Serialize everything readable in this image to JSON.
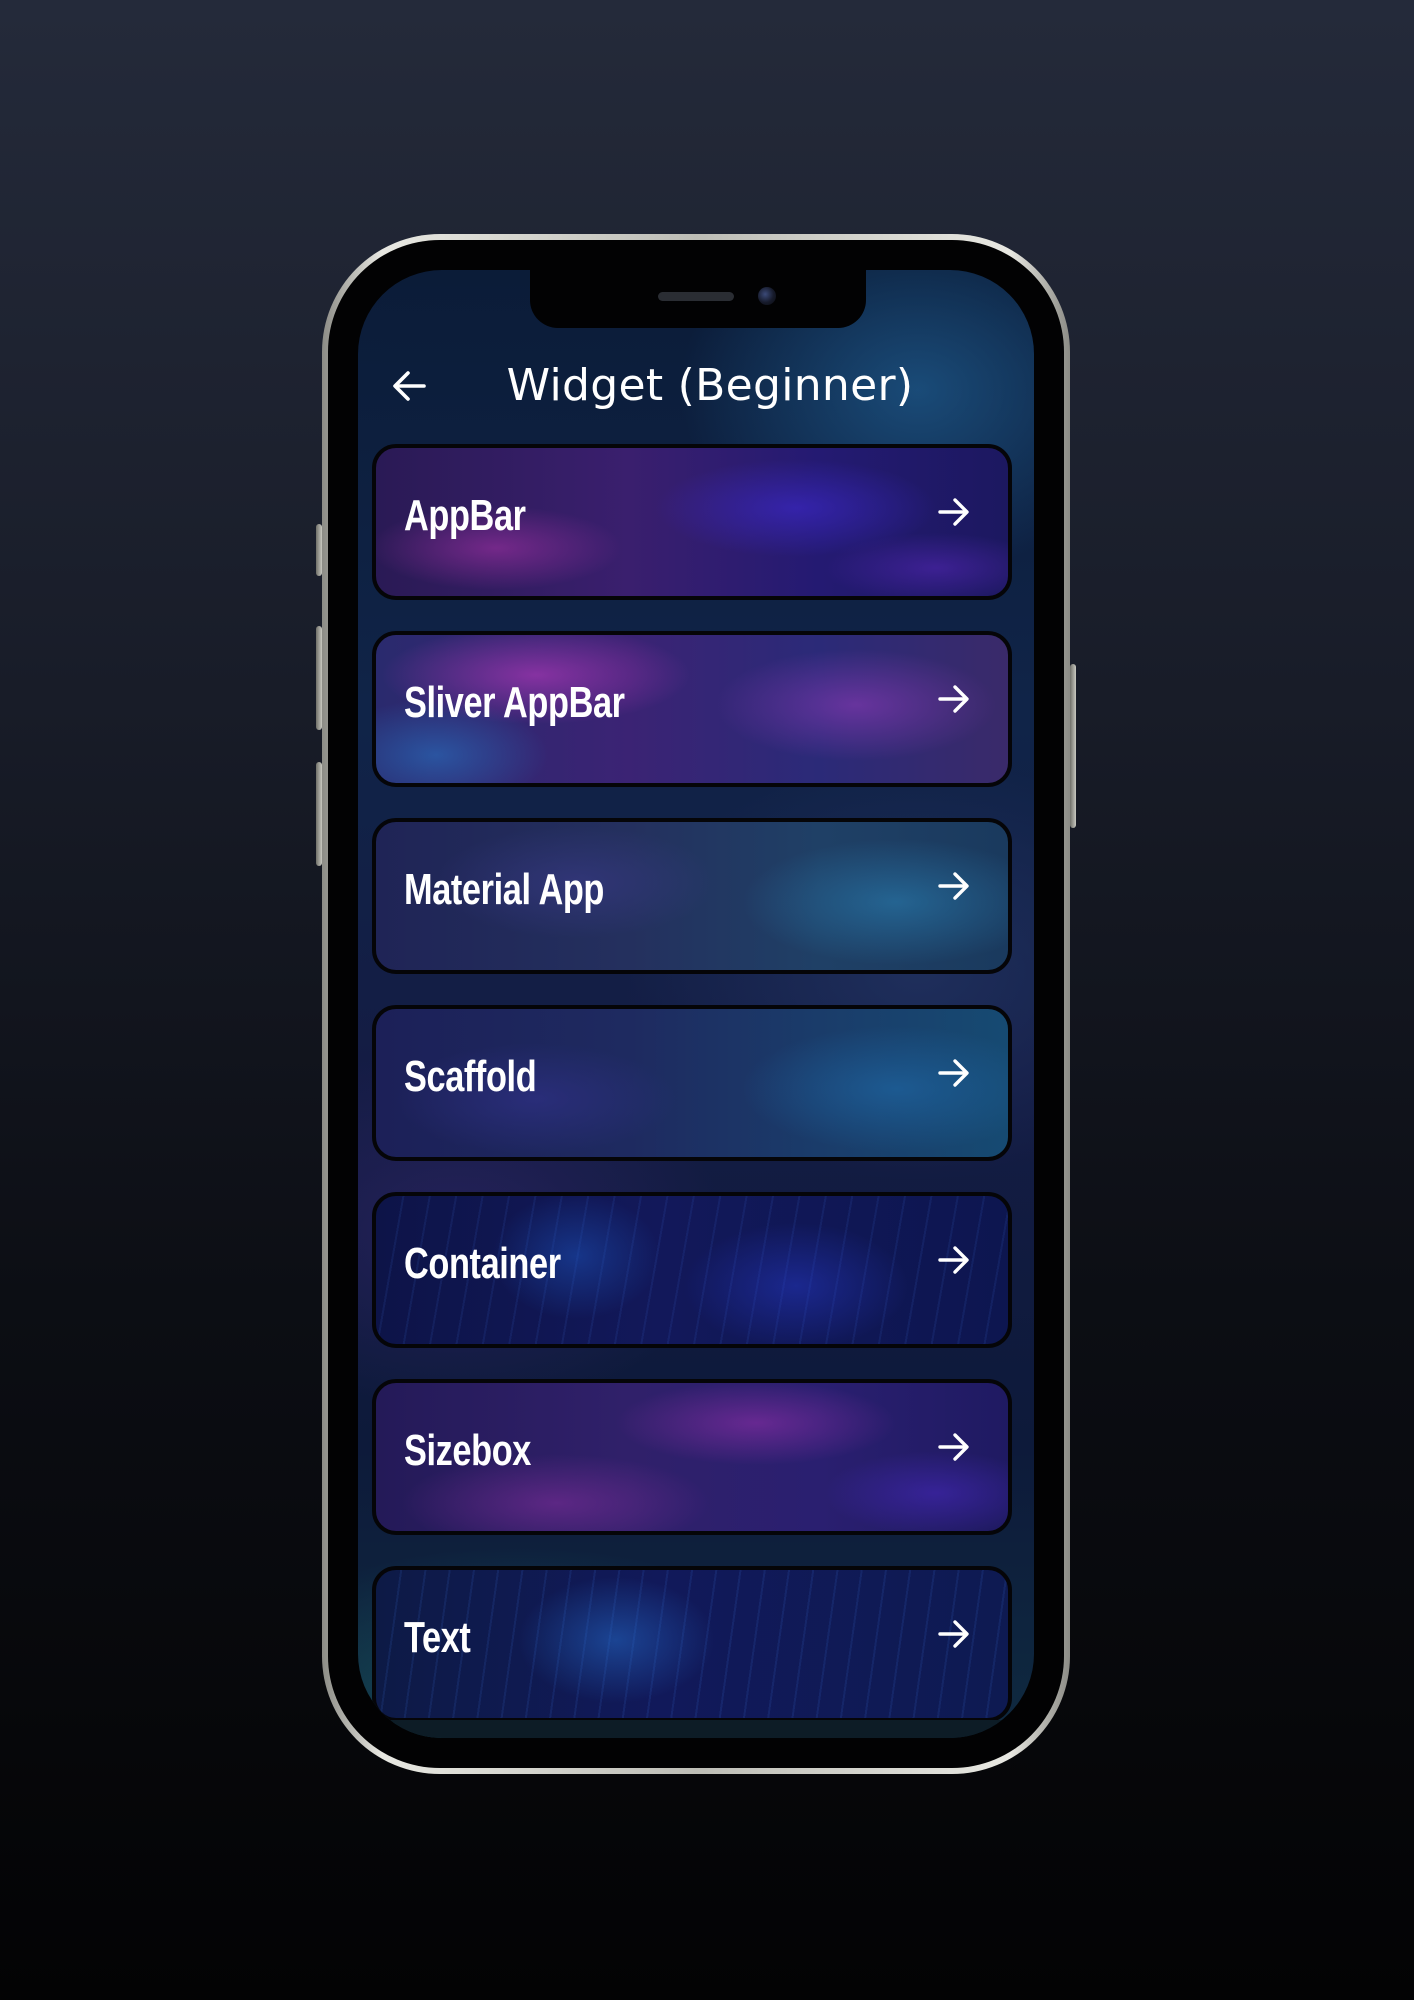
{
  "header": {
    "title": "Widget (Beginner)",
    "back_icon": "arrow-left-icon"
  },
  "items": [
    {
      "label": "AppBar",
      "icon": "arrow-right-icon"
    },
    {
      "label": "Sliver AppBar",
      "icon": "arrow-right-icon"
    },
    {
      "label": "Material App",
      "icon": "arrow-right-icon"
    },
    {
      "label": "Scaffold",
      "icon": "arrow-right-icon"
    },
    {
      "label": "Container",
      "icon": "arrow-right-icon"
    },
    {
      "label": "Sizebox",
      "icon": "arrow-right-icon"
    },
    {
      "label": "Text",
      "icon": "arrow-right-icon"
    }
  ],
  "colors": {
    "text": "#ffffff",
    "card_border": "#050508",
    "background_top": "#242a3a",
    "background_bottom": "#030304"
  }
}
